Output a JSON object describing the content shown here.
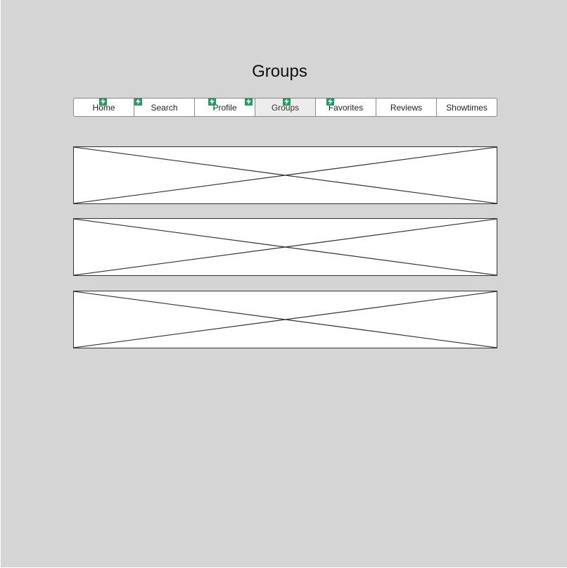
{
  "page": {
    "title": "Groups"
  },
  "tabs": [
    {
      "label": "Home",
      "selected": false
    },
    {
      "label": "Search",
      "selected": false
    },
    {
      "label": "Profile",
      "selected": false
    },
    {
      "label": "Groups",
      "selected": true
    },
    {
      "label": "Favorites",
      "selected": false
    },
    {
      "label": "Reviews",
      "selected": false
    },
    {
      "label": "Showtimes",
      "selected": false
    }
  ],
  "link_badges": {
    "icon": "lightning-bolt-icon",
    "color": "#1e9e5f",
    "count": 6
  },
  "content": {
    "image_placeholders": [
      {
        "icon": "image-placeholder-icon"
      },
      {
        "icon": "image-placeholder-icon"
      },
      {
        "icon": "image-placeholder-icon"
      }
    ]
  },
  "colors": {
    "background": "#d5d5d5",
    "tab_selected": "#ececec",
    "placeholder_fill": "#ffffff"
  }
}
